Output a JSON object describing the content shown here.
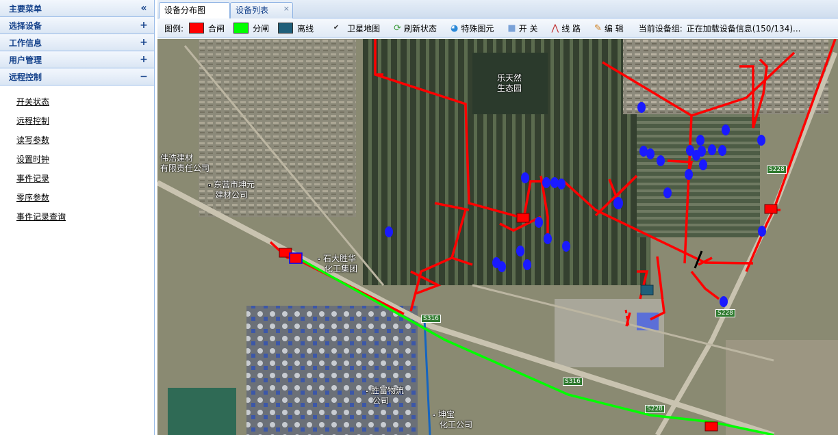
{
  "sidebar": {
    "sections": [
      {
        "label": "主要菜单",
        "tool": "«"
      },
      {
        "label": "选择设备",
        "tool": "+"
      },
      {
        "label": "工作信息",
        "tool": "+"
      },
      {
        "label": "用户管理",
        "tool": "+"
      },
      {
        "label": "远程控制",
        "tool": "−"
      }
    ],
    "links": [
      "开关状态",
      "远程控制",
      "读写参数",
      "设置时钟",
      "事件记录",
      "零序参数",
      "事件记录查询"
    ]
  },
  "tabs": [
    {
      "label": "设备分布图",
      "active": true
    },
    {
      "label": "设备列表",
      "active": false,
      "close": "×"
    }
  ],
  "toolbar": {
    "legend_label": "图例:",
    "legend": [
      {
        "label": "合闸",
        "color": "#ff0000"
      },
      {
        "label": "分闸",
        "color": "#00ff00"
      },
      {
        "label": "离线",
        "color": "#1f5f7a"
      }
    ],
    "satellite_check": "✔",
    "satellite_label": "卫星地图",
    "buttons": [
      {
        "label": "刷新状态",
        "icon": "refresh-icon"
      },
      {
        "label": "特殊图元",
        "icon": "special-element-icon"
      },
      {
        "label": "开 关",
        "icon": "switch-icon"
      },
      {
        "label": "线 路",
        "icon": "line-icon"
      },
      {
        "label": "编 辑",
        "icon": "pencil-icon"
      }
    ],
    "group_label": "当前设备组:",
    "group_value": "正在加载设备信息(150/134)..."
  },
  "map": {
    "labels": [
      "乐天然",
      "生态园",
      "伟浩建材",
      "有限责任公司",
      "东营市坤元",
      "建材公司",
      "石大胜华",
      "化工集团",
      "胜富物流",
      "公司",
      "坤宝",
      "化工公司"
    ],
    "road_badges": [
      "S228",
      "S228",
      "S316",
      "S316",
      "S228"
    ],
    "colors": {
      "closed": "#ff0000",
      "open": "#00ff00",
      "offline": "#1f5f7a",
      "device": "#1a1aff",
      "blue_line": "#1565c0"
    }
  }
}
